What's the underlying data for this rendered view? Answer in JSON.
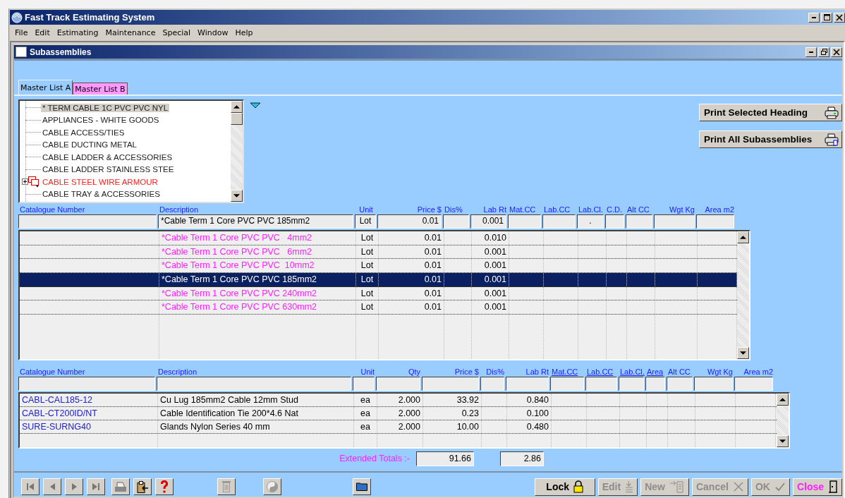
{
  "window": {
    "title": "Fast Track Estimating System"
  },
  "menu": [
    "File",
    "Edit",
    "Estimating",
    "Maintenance",
    "Special",
    "Window",
    "Help"
  ],
  "child_window": {
    "title": "Subassemblies"
  },
  "tabs": [
    {
      "label": "Master List A",
      "selected": true
    },
    {
      "label": "Master List B",
      "selected": false
    }
  ],
  "tree": {
    "items": [
      {
        "label": "* TERM CABLE 1C PVC PVC NYL",
        "kind": "leaf",
        "selected": true
      },
      {
        "label": "APPLIANCES - WHITE GOODS",
        "kind": "leaf",
        "selected": false
      },
      {
        "label": "CABLE ACCESS/TIES",
        "kind": "leaf",
        "selected": false
      },
      {
        "label": "CABLE DUCTING METAL",
        "kind": "leaf",
        "selected": false
      },
      {
        "label": "CABLE LADDER & ACCESSORIES",
        "kind": "leaf",
        "selected": false
      },
      {
        "label": "CABLE LADDER STAINLESS STEE",
        "kind": "leaf",
        "selected": false
      },
      {
        "label": "CABLE STEEL WIRE ARMOUR",
        "kind": "group",
        "selected": false
      },
      {
        "label": "CABLE TRAY & ACCESSORIES",
        "kind": "leaf",
        "selected": false
      }
    ]
  },
  "print_buttons": [
    "Print Selected Heading",
    "Print All Subassemblies"
  ],
  "upper_table": {
    "columns": [
      "Catalogue Number",
      "Description",
      "Unit",
      "Price $",
      "Dis%",
      "Lab Rt",
      "Mat.CC",
      "Lab.CC",
      "Lab.Cl.",
      "C.D.",
      "Alt CC",
      "Wgt Kg",
      "Area m2"
    ],
    "filter_row": {
      "description": "*Cable Term 1 Core PVC PVC 185mm2",
      "unit": "Lot",
      "price": "0.01",
      "lab_rt": "0.001",
      "lab_cl": "."
    },
    "rows": [
      {
        "description": "*Cable Term 1 Core PVC PVC   4mm2",
        "unit": "Lot",
        "price": "0.01",
        "lab_rt": "0.010",
        "selected": false
      },
      {
        "description": "*Cable Term 1 Core PVC PVC   6mm2",
        "unit": "Lot",
        "price": "0.01",
        "lab_rt": "0.001",
        "selected": false
      },
      {
        "description": "*Cable Term 1 Core PVC PVC  10mm2",
        "unit": "Lot",
        "price": "0.01",
        "lab_rt": "0.001",
        "selected": false
      },
      {
        "description": "*Cable Term 1 Core PVC PVC 185mm2",
        "unit": "Lot",
        "price": "0.01",
        "lab_rt": "0.001",
        "selected": true
      },
      {
        "description": "*Cable Term 1 Core PVC PVC 240mm2",
        "unit": "Lot",
        "price": "0.01",
        "lab_rt": "0.001",
        "selected": false
      },
      {
        "description": "*Cable Term 1 Core PVC PVC 630mm2",
        "unit": "Lot",
        "price": "0.01",
        "lab_rt": "0.001",
        "selected": false
      }
    ]
  },
  "lower_table": {
    "columns": [
      {
        "label": "Catalogue Number",
        "link": false
      },
      {
        "label": "Description",
        "link": false
      },
      {
        "label": "Unit",
        "link": false
      },
      {
        "label": "Qty",
        "link": false
      },
      {
        "label": "Price $",
        "link": false
      },
      {
        "label": "Dis%",
        "link": false
      },
      {
        "label": "Lab Rt",
        "link": false
      },
      {
        "label": "Mat.CC",
        "link": true
      },
      {
        "label": "Lab.CC",
        "link": true
      },
      {
        "label": "Lab.Cl.",
        "link": true
      },
      {
        "label": "Area",
        "link": true
      },
      {
        "label": "Alt CC",
        "link": false
      },
      {
        "label": "Wgt Kg",
        "link": false
      },
      {
        "label": "Area m2",
        "link": false
      }
    ],
    "rows": [
      {
        "catalogue_number": "CABL-CAL185-12",
        "description": "Cu Lug 185mm2 Cable 12mm Stud",
        "unit": "ea",
        "qty": "2.000",
        "price": "33.92",
        "lab_rt": "0.840"
      },
      {
        "catalogue_number": "CABL-CT200ID/NT",
        "description": "Cable Identification Tie 200*4.6 Nat",
        "unit": "ea",
        "qty": "2.000",
        "price": "0.23",
        "lab_rt": "0.100"
      },
      {
        "catalogue_number": "SURE-SURNG40",
        "description": "Glands Nylon Series 40 mm",
        "unit": "ea",
        "qty": "2.000",
        "price": "10.00",
        "lab_rt": "0.480"
      }
    ]
  },
  "totals": {
    "label": "Extended Totals :-",
    "price": "91.66",
    "lab_rt": "2.86"
  },
  "action_buttons": [
    {
      "label": "Lock",
      "kind": "lock",
      "disabled": false
    },
    {
      "label": "Edit",
      "kind": "edit",
      "disabled": true
    },
    {
      "label": "New",
      "kind": "new",
      "disabled": true
    },
    {
      "label": "Cancel",
      "kind": "cancel",
      "disabled": true
    },
    {
      "label": "OK",
      "kind": "ok",
      "disabled": true
    },
    {
      "label": "Close",
      "kind": "close",
      "disabled": false
    }
  ]
}
